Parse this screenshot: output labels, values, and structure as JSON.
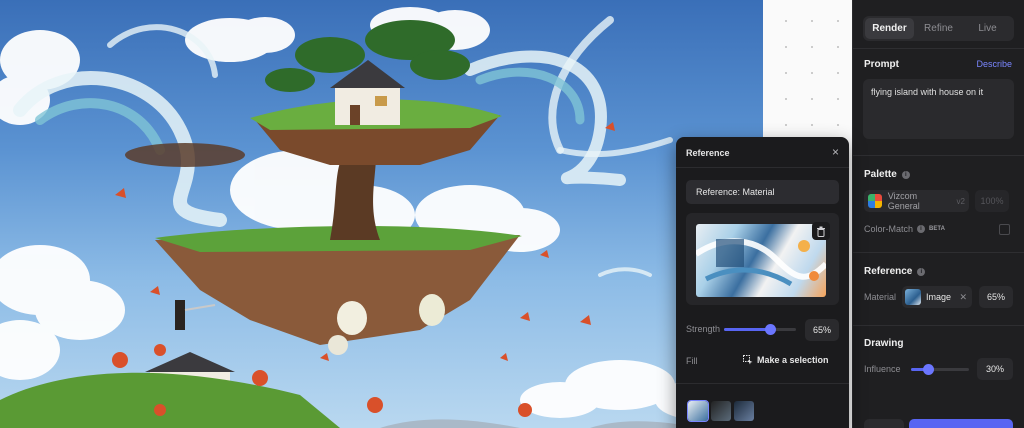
{
  "tabs": [
    {
      "label": "Render",
      "active": true
    },
    {
      "label": "Refine",
      "active": false
    },
    {
      "label": "Live",
      "active": false
    }
  ],
  "prompt": {
    "title": "Prompt",
    "describe_label": "Describe",
    "text": "flying island with house on it"
  },
  "palette": {
    "title": "Palette",
    "name": "Vizcom General",
    "version": "v2",
    "strength": "100%",
    "color_match_label": "Color-Match",
    "beta_label": "BETA"
  },
  "reference_section": {
    "title": "Reference",
    "material_label": "Material",
    "image_label": "Image",
    "value": "65%"
  },
  "drawing": {
    "title": "Drawing",
    "influence_label": "Influence",
    "influence_value": "30%",
    "influence_fraction": 0.3
  },
  "popup": {
    "title": "Reference",
    "close_glyph": "×",
    "reference_type": "Reference: Material",
    "strength_label": "Strength",
    "strength_value": "65%",
    "strength_fraction": 0.65,
    "fill_label": "Fill",
    "make_selection_label": "Make a selection"
  },
  "colors": {
    "accent": "#5865f2",
    "panel_bg": "#1f1f21",
    "popup_bg": "#1b1b1d",
    "describe_link": "#7a86ff"
  }
}
